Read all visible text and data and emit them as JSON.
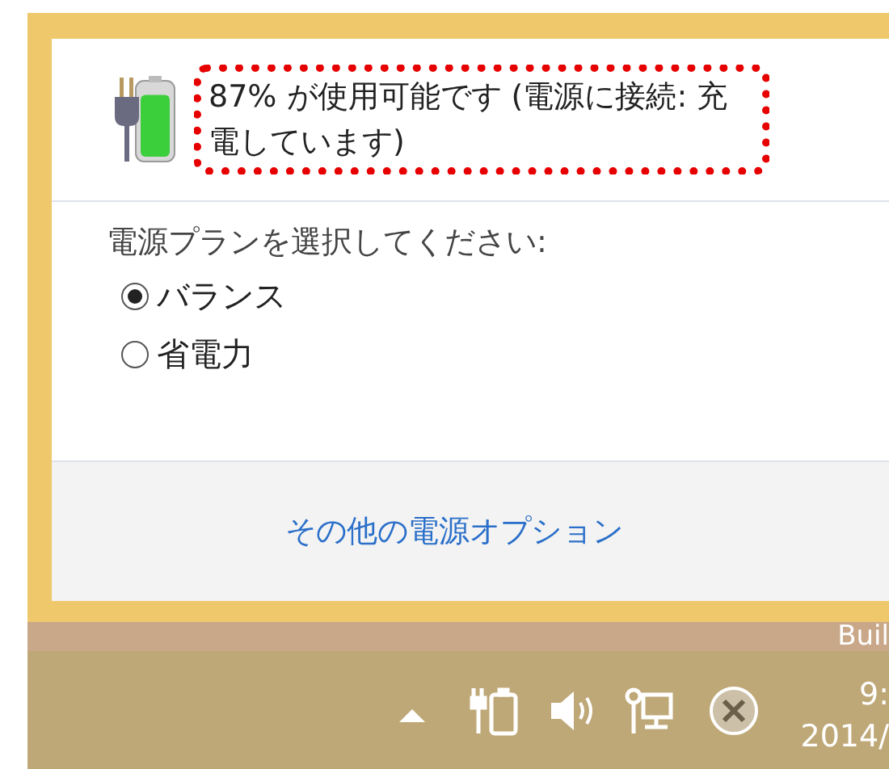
{
  "status": {
    "text": "87% が使用可能です (電源に接続: 充電しています)",
    "level": 0.87,
    "highlighted": true
  },
  "plan_prompt": "電源プランを選択してください:",
  "plans": [
    {
      "label": "バランス",
      "selected": true
    },
    {
      "label": "省電力",
      "selected": false
    }
  ],
  "more_link": "その他の電源オプション",
  "desktop_text": "Buil",
  "taskbar": {
    "clock_time": "9:",
    "clock_date": "2014/"
  }
}
